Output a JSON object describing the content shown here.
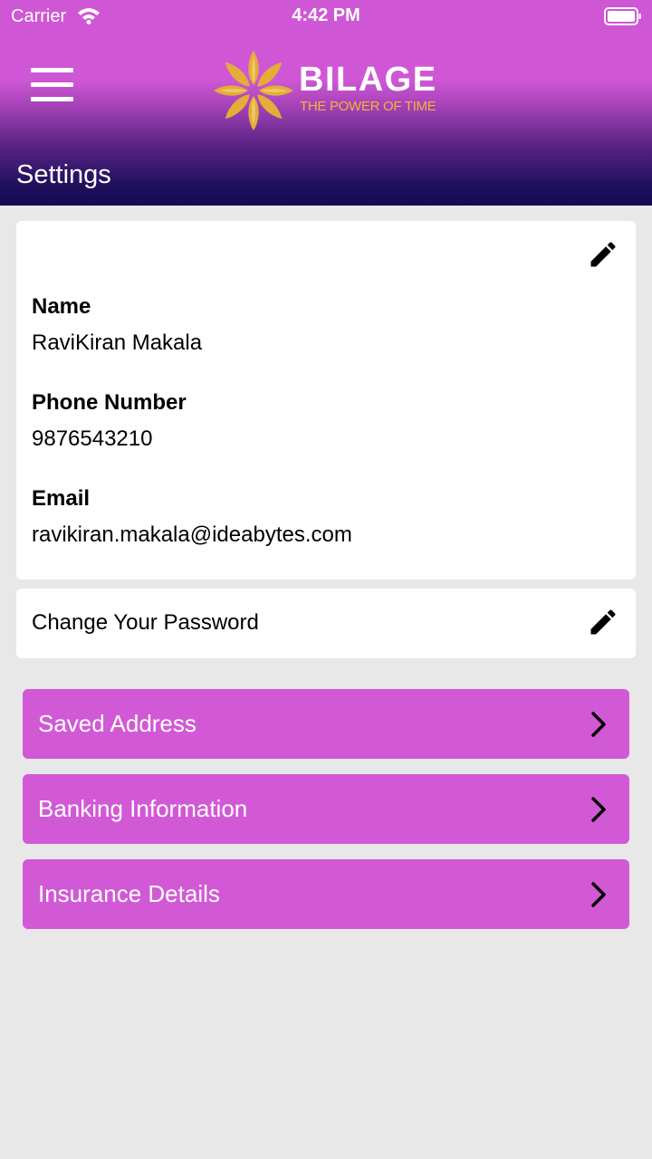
{
  "status_bar": {
    "carrier": "Carrier",
    "time": "4:42 PM"
  },
  "header": {
    "brand_name": "BILAGE",
    "brand_tagline": "THE POWER OF TIME",
    "page_title": "Settings"
  },
  "profile": {
    "name_label": "Name",
    "name_value": "RaviKiran Makala",
    "phone_label": "Phone Number",
    "phone_value": "9876543210",
    "email_label": "Email",
    "email_value": "ravikiran.makala@ideabytes.com"
  },
  "password": {
    "label": "Change Your Password"
  },
  "menu": [
    {
      "label": "Saved Address"
    },
    {
      "label": "Banking Information"
    },
    {
      "label": "Insurance Details"
    }
  ],
  "colors": {
    "header_top": "#cf57d6",
    "header_bottom": "#150b52",
    "menu_button": "#d259d6",
    "tagline": "#f2b33a",
    "background": "#e8e8e8"
  }
}
